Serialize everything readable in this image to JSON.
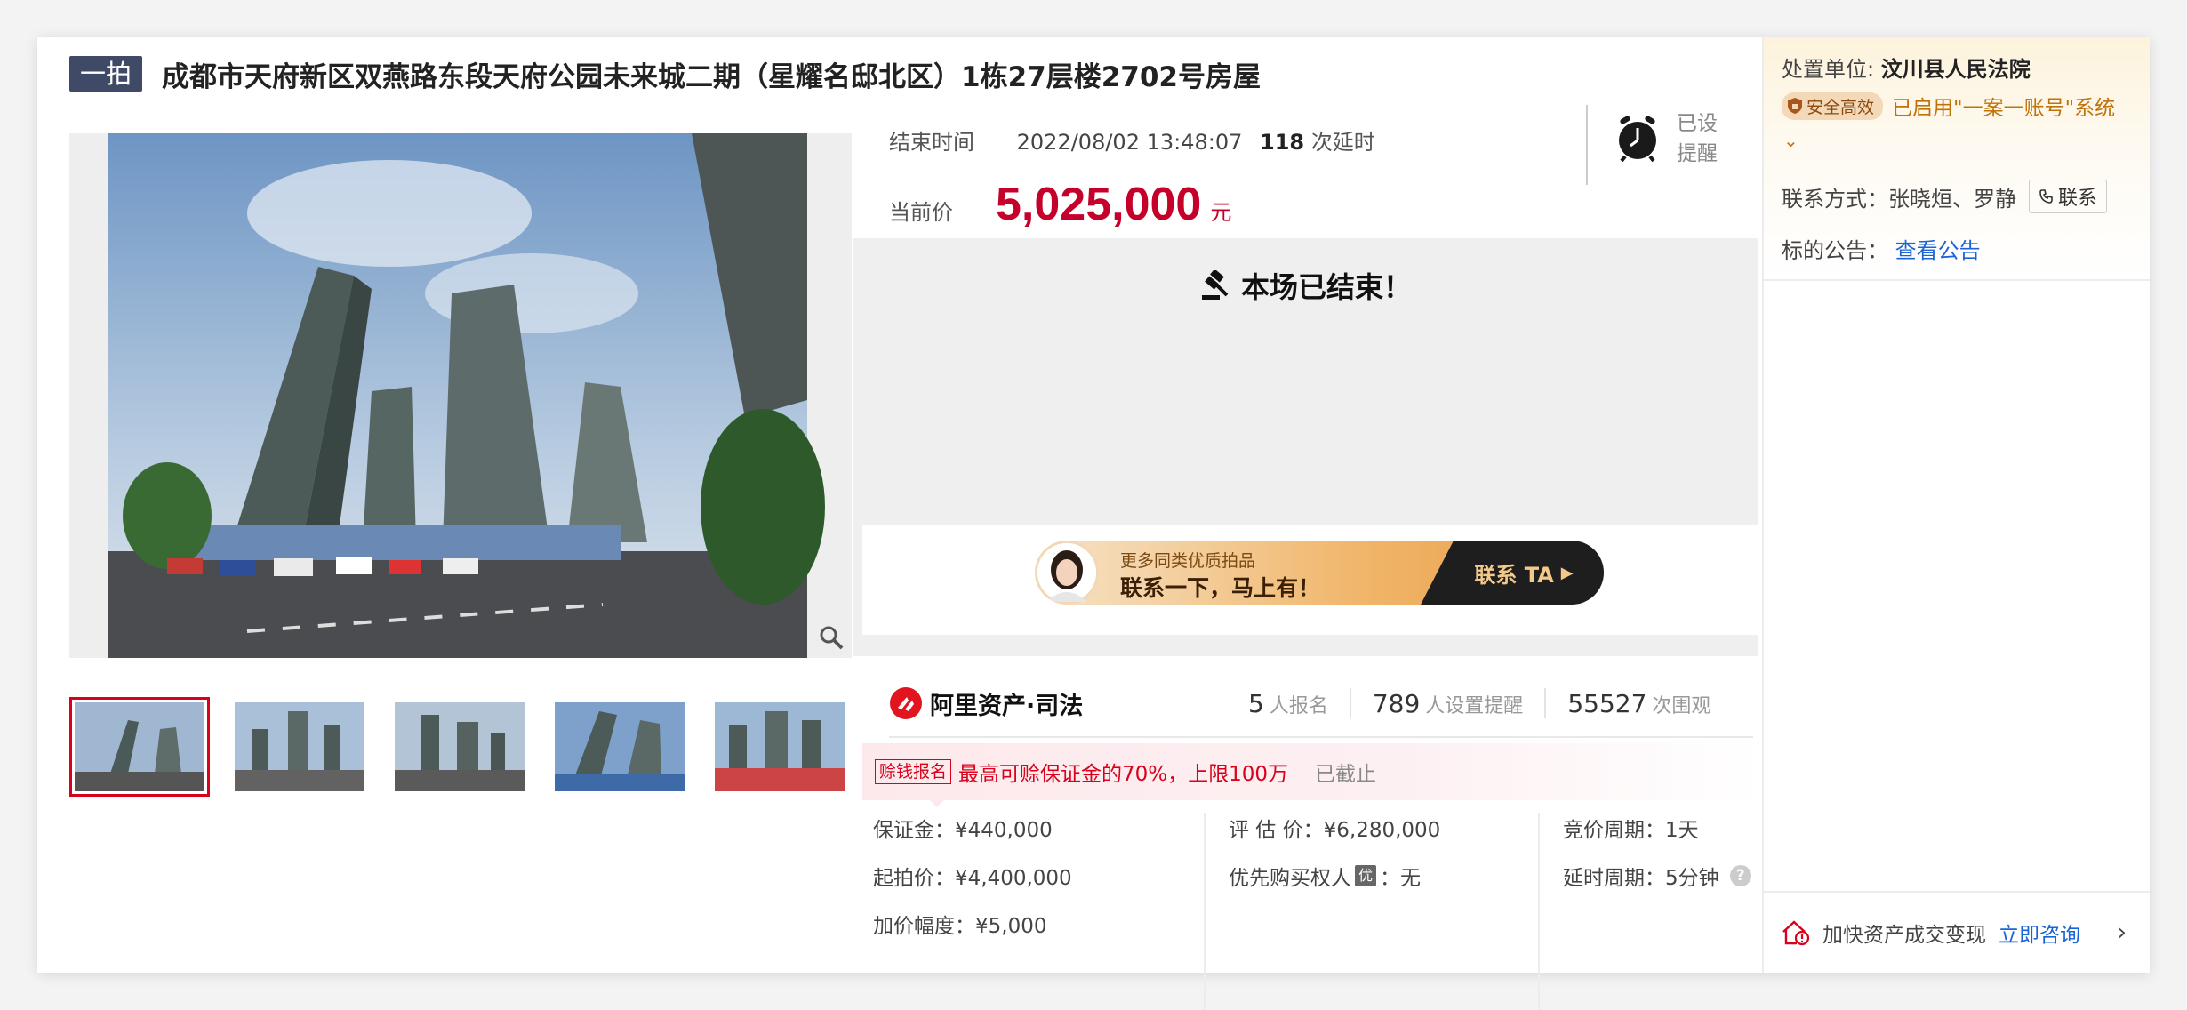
{
  "listing": {
    "badge": "一拍",
    "title": "成都市天府新区双燕路东段天府公园未来城二期（星耀名邸北区）1栋27层楼2702号房屋"
  },
  "timing": {
    "end_label": "结束时间",
    "end_time": "2022/08/02 13:48:07",
    "delay_count": "118",
    "delay_label": "次延时"
  },
  "price": {
    "label": "当前价",
    "value": "5,025,000",
    "unit": "元"
  },
  "reminder": {
    "line1": "已设",
    "line2": "提醒",
    "icon": "alarm-clock-icon"
  },
  "status": {
    "ended": "本场已结束！"
  },
  "promo": {
    "line1": "更多同类优质拍品",
    "line2": "联系一下，马上有！",
    "cta": "联系 TA"
  },
  "brand": {
    "name": "阿里资产·司法"
  },
  "stats": [
    {
      "num": "5",
      "label": "人报名"
    },
    {
      "num": "789",
      "label": "人设置提醒"
    },
    {
      "num": "55527",
      "label": "次围观"
    }
  ],
  "notice": {
    "tag": "赊钱报名",
    "text": "最高可赊保证金的70%，上限100万",
    "status": "已截止"
  },
  "params": {
    "deposit": "保证金：¥440,000",
    "start_price": "起拍价：¥4,400,000",
    "increment": "加价幅度：¥5,000",
    "appraisal": "评 估 价：¥6,280,000",
    "priority_prefix": "优先购买权人",
    "priority_badge": "优",
    "priority_value": "：无",
    "cycle": "竞价周期：1天",
    "delay_cycle": "延时周期：5分钟",
    "help_mark": "?"
  },
  "side": {
    "court_label": "处置单位:",
    "court_name": "汶川县人民法院",
    "safe_badge": "安全高效",
    "safe_text": "已启用\"一案一账号\"系统",
    "caret": "⌄",
    "contact_label": "联系方式：张晓烜、罗静",
    "contact_button": "联系",
    "announce_label": "标的公告：",
    "announce_link": "查看公告",
    "bottom_text": "加快资产成交变现",
    "bottom_link": "立即咨询",
    "bottom_chevron": "›"
  },
  "colors": {
    "accent_red": "#c5002a",
    "link_blue": "#1a64d6",
    "badge_navy": "#3e4a66"
  }
}
